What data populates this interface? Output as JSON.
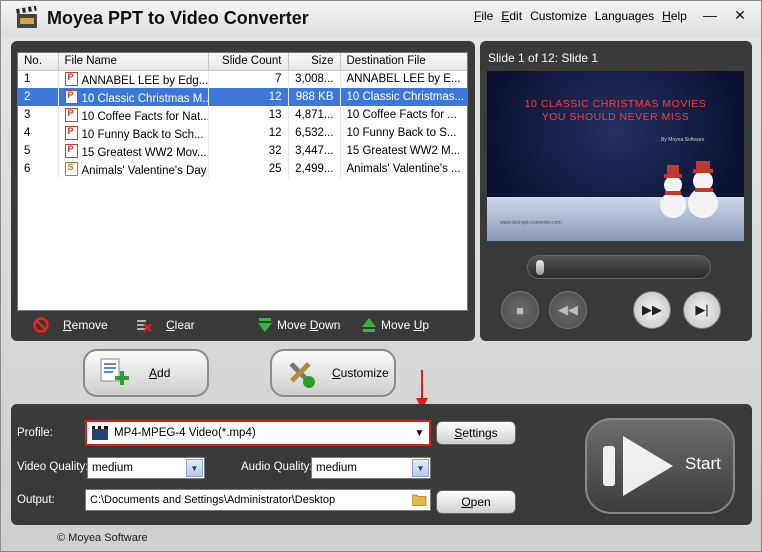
{
  "window": {
    "title": "Moyea PPT to Video Converter",
    "menu": [
      {
        "label": "File",
        "accel": "F",
        "rest": "ile"
      },
      {
        "label": "Edit",
        "accel": "E",
        "rest": "dit"
      },
      {
        "label": "Customize",
        "accel": "",
        "rest": "Customize"
      },
      {
        "label": "Languages",
        "accel": "",
        "rest": "Languages"
      },
      {
        "label": "Help",
        "accel": "H",
        "rest": "elp"
      }
    ],
    "minimize_glyph": "—",
    "close_glyph": "✕"
  },
  "file_list": {
    "columns": [
      "No.",
      "File Name",
      "Slide Count",
      "Size",
      "Destination File"
    ],
    "rows": [
      {
        "no": "1",
        "name": "ANNABEL LEE by Edg...",
        "slides": "7",
        "size": "3,008...",
        "dest": "ANNABEL LEE by E...",
        "icon": "ppt"
      },
      {
        "no": "2",
        "name": "10 Classic Christmas M...",
        "slides": "12",
        "size": "988 KB",
        "dest": "10 Classic Christmas...",
        "icon": "ppt"
      },
      {
        "no": "3",
        "name": "10 Coffee Facts for Nat...",
        "slides": "13",
        "size": "4,871...",
        "dest": "10 Coffee Facts for ...",
        "icon": "ppt"
      },
      {
        "no": "4",
        "name": "10 Funny Back to Sch...",
        "slides": "12",
        "size": "6,532...",
        "dest": "10 Funny Back to S...",
        "icon": "ppt"
      },
      {
        "no": "5",
        "name": "15 Greatest WW2 Mov...",
        "slides": "32",
        "size": "3,447...",
        "dest": "15 Greatest WW2 M...",
        "icon": "ppt"
      },
      {
        "no": "6",
        "name": "Animals' Valentine's Day",
        "slides": "25",
        "size": "2,499...",
        "dest": "Animals' Valentine's ...",
        "icon": "pps"
      }
    ],
    "selected_row": 1
  },
  "toolbar": {
    "remove": {
      "accel": "R",
      "rest": "emove"
    },
    "clear": {
      "accel": "C",
      "rest": "lear"
    },
    "move_down": {
      "pre": "Move ",
      "accel": "D",
      "rest": "own"
    },
    "move_up": {
      "pre": "Move ",
      "accel": "U",
      "rest": "p"
    }
  },
  "preview": {
    "slide_info": "Slide 1 of 12: Slide 1",
    "slide_title_line1": "10 CLASSIC CHRISTMAS MOVIES",
    "slide_title_line2": "YOU SHOULD NEVER MISS",
    "slide_byline": "By Moyea Software",
    "slide_url": "www.dvd-ppt-converter.com",
    "progress": 0.0
  },
  "actions": {
    "add": {
      "accel": "A",
      "rest": "dd"
    },
    "customize": {
      "accel": "C",
      "rest": "ustomize"
    }
  },
  "settings": {
    "profile_label": "Profile:",
    "profile_value": "MP4-MPEG-4 Video(*.mp4)",
    "settings_button": {
      "accel": "S",
      "rest": "ettings"
    },
    "video_quality_label": "Video Quality:",
    "video_quality_value": "medium",
    "audio_quality_label": "Audio Quality:",
    "audio_quality_value": "medium",
    "output_label": "Output:",
    "output_value": "C:\\Documents and Settings\\Administrator\\Desktop",
    "open_button": {
      "accel": "O",
      "rest": "pen"
    },
    "start_label": "Start"
  },
  "footer": "© Moyea Software",
  "colors": {
    "selection": "#3d78d8",
    "panel": "#3a3a3a",
    "annotation_red": "#e21b1b"
  }
}
